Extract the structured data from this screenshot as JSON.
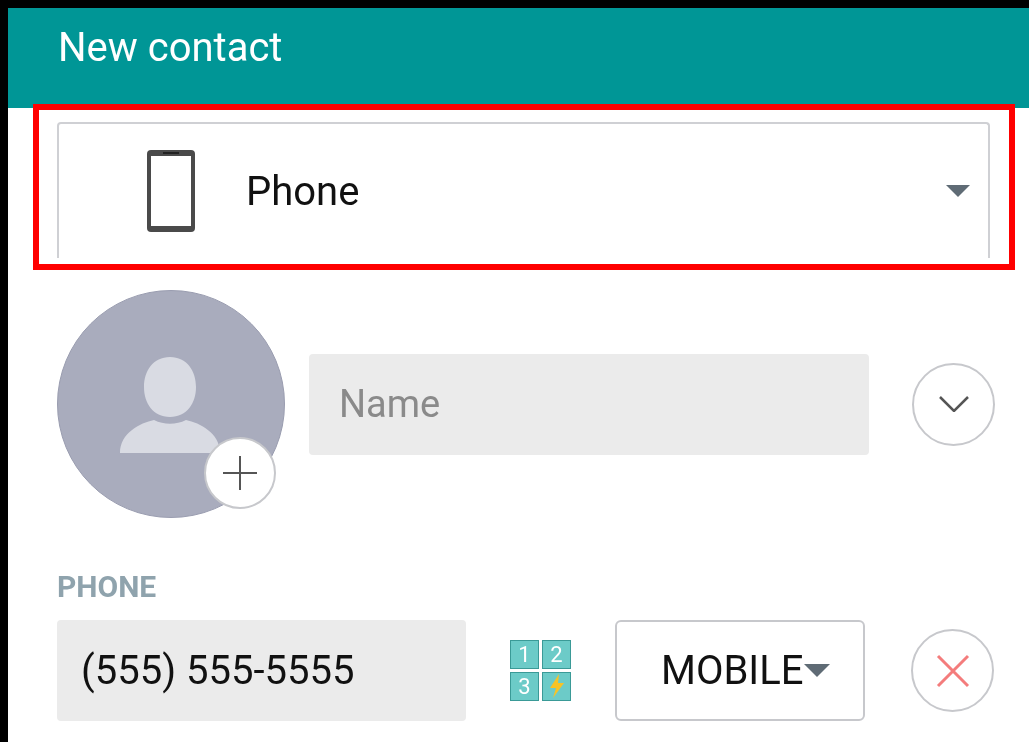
{
  "header": {
    "title": "New contact"
  },
  "account_selector": {
    "label": "Phone",
    "highlighted": true
  },
  "name_field": {
    "placeholder": "Name"
  },
  "phone_section": {
    "label": "PHONE",
    "number": "(555) 555-5555",
    "speed_dial_keys": [
      "1",
      "2",
      "3"
    ],
    "type": "MOBILE"
  }
}
